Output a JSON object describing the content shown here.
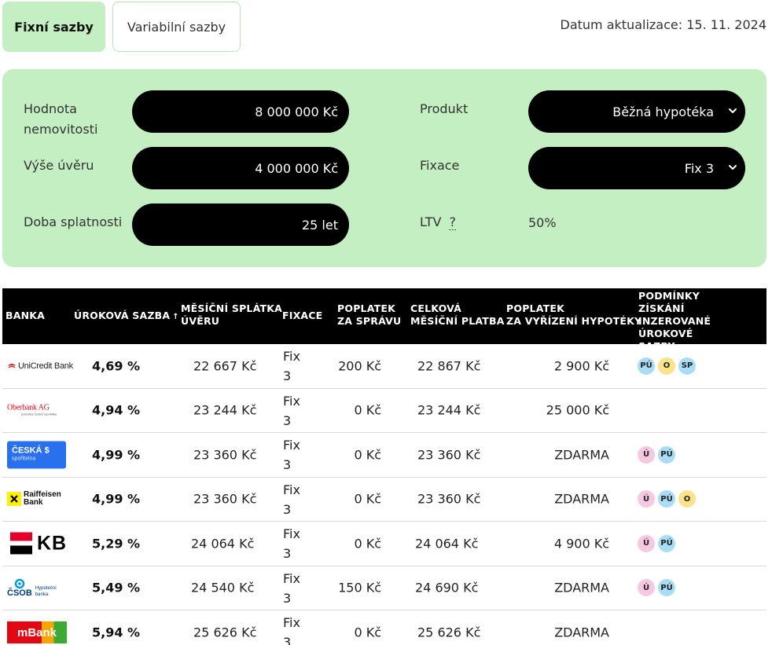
{
  "tabs": [
    {
      "label": "Fixní sazby"
    },
    {
      "label": "Variabilní sazby"
    }
  ],
  "update_date": "Datum aktualizace: 15. 11. 2024",
  "filters": {
    "property_value_label": "Hodnota nemovitosti",
    "property_value": "8 000 000 Kč",
    "loan_amount_label": "Výše úvěru",
    "loan_amount": "4 000 000 Kč",
    "term_label": "Doba splatnosti",
    "term": "25 let",
    "product_label": "Produkt",
    "product": "Běžná hypotéka",
    "fixation_label": "Fixace",
    "fixation": "Fix 3",
    "ltv_label": "LTV",
    "ltv_help": "?",
    "ltv_value": "50%"
  },
  "table": {
    "headers": {
      "bank": "BANKA",
      "rate": "ÚROKOVÁ SAZBA",
      "rate_sort": "↑",
      "monthly_1": "MĚSÍČNÍ SPLÁTKA",
      "monthly_2": "ÚVĚRU",
      "fixation": "FIXACE",
      "fee_1": "POPLATEK",
      "fee_2": "ZA SPRÁVU",
      "total_1": "CELKOVÁ",
      "total_2": "MĚSÍČNÍ PLATBA",
      "handling_1": "POPLATEK",
      "handling_2": "ZA VYŘÍZENÍ HYPOTÉKY",
      "cond_1": "PODMÍNKY",
      "cond_2": "ZÍSKÁNÍ",
      "cond_3": "INZEROVANÉ ÚROKOVÉ",
      "cond_4": "SAZBY"
    },
    "rows": [
      {
        "bank": "UniCredit Bank",
        "rate": "4,69 %",
        "monthly": "22 667 Kč",
        "fix_a": "Fix",
        "fix_b": "3",
        "fee": "200 Kč",
        "total": "22 867 Kč",
        "handling": "2 900 Kč",
        "badges": [
          "PÚ",
          "O",
          "SP"
        ]
      },
      {
        "bank": "Oberbank AG",
        "bank_sub": "pobočka Česká republika",
        "rate": "4,94 %",
        "monthly": "23 244 Kč",
        "fix_a": "Fix",
        "fix_b": "3",
        "fee": "0 Kč",
        "total": "23 244 Kč",
        "handling": "25 000 Kč",
        "badges": []
      },
      {
        "bank": "ČESKÁ",
        "bank_sub": "spořitelna",
        "rate": "4,99 %",
        "monthly": "23 360 Kč",
        "fix_a": "Fix",
        "fix_b": "3",
        "fee": "0 Kč",
        "total": "23 360 Kč",
        "handling": "ZDARMA",
        "badges": [
          "Ú",
          "PÚ"
        ]
      },
      {
        "bank": "Raiffeisen",
        "bank_sub": "Bank",
        "rate": "4,99 %",
        "monthly": "23 360 Kč",
        "fix_a": "Fix",
        "fix_b": "3",
        "fee": "0 Kč",
        "total": "23 360 Kč",
        "handling": "ZDARMA",
        "badges": [
          "Ú",
          "PÚ",
          "O"
        ]
      },
      {
        "bank": "KB",
        "rate": "5,29 %",
        "monthly": "24 064 Kč",
        "fix_a": "Fix",
        "fix_b": "3",
        "fee": "0 Kč",
        "total": "24 064 Kč",
        "handling": "4 900 Kč",
        "badges": [
          "Ú",
          "PÚ"
        ]
      },
      {
        "bank": "ČSOB",
        "bank_sub": "Hypoteční banka",
        "rate": "5,49 %",
        "monthly": "24 540 Kč",
        "fix_a": "Fix",
        "fix_b": "3",
        "fee": "150 Kč",
        "total": "24 690 Kč",
        "handling": "ZDARMA",
        "badges": [
          "Ú",
          "PÚ"
        ]
      },
      {
        "bank": "mBank",
        "rate": "5,94 %",
        "monthly": "25 626 Kč",
        "fix_a": "Fix",
        "fix_b": "3",
        "fee": "0 Kč",
        "total": "25 626 Kč",
        "handling": "ZDARMA",
        "badges": []
      }
    ]
  },
  "colors": {
    "accent_green": "#c4efc2",
    "unicredit_red": "#e2231a",
    "oberbank_red": "#e30613",
    "csas_blue": "#2870ed",
    "raiffeisen_yellow": "#fff200",
    "kb_red": "#e4002b",
    "csob_blue": "#0099d8",
    "mbank_red": "#e30613"
  }
}
